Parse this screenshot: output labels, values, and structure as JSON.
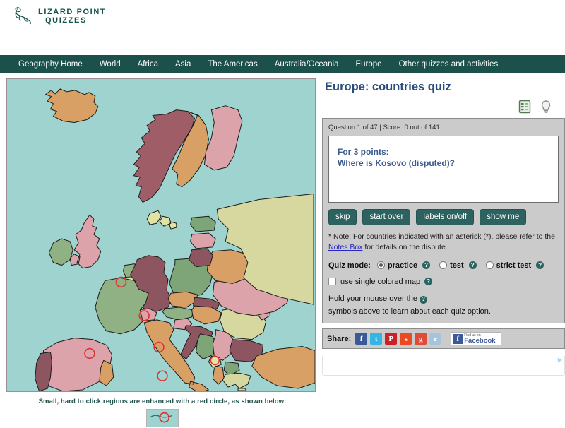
{
  "site": {
    "logo_line1": "LIZARD POINT",
    "logo_line2": "QUIZZES",
    "logo_icon": "lizard-icon"
  },
  "nav": {
    "items": [
      {
        "label": "Geography Home"
      },
      {
        "label": "World"
      },
      {
        "label": "Africa"
      },
      {
        "label": "Asia"
      },
      {
        "label": "The Americas"
      },
      {
        "label": "Australia/Oceania"
      },
      {
        "label": "Europe"
      },
      {
        "label": "Other quizzes and activities"
      }
    ]
  },
  "quiz": {
    "title": "Europe: countries quiz",
    "notes_icon": "notes-document-icon",
    "hint_icon": "lightbulb-icon",
    "status": "Question 1 of 47 | Score: 0 out of 141",
    "question_line1": "For 3 points:",
    "question_line2": "Where is Kosovo (disputed)?",
    "buttons": [
      {
        "label": "skip",
        "name": "skip-button"
      },
      {
        "label": "start over",
        "name": "start-over-button"
      },
      {
        "label": "labels on/off",
        "name": "labels-toggle-button"
      },
      {
        "label": "show me",
        "name": "show-me-button"
      }
    ],
    "note_prefix": "* Note: For countries indicated with an asterisk (*), please refer to the ",
    "note_link": "Notes Box",
    "note_suffix": " for details on the dispute.",
    "mode_label": "Quiz mode:",
    "modes": [
      {
        "label": "practice",
        "selected": true
      },
      {
        "label": "test",
        "selected": false
      },
      {
        "label": "strict test",
        "selected": false
      }
    ],
    "single_map_label": "use single colored map",
    "single_map_checked": false,
    "help_glyph": "?",
    "hint_before": "Hold your mouse over the",
    "hint_after": "symbols above to learn about each quiz option."
  },
  "map": {
    "caption": "Small, hard to click regions are enhanced with a red circle, as shown below:",
    "ocean_color": "#9fd3d0",
    "border_color": "#9a8f96",
    "highlight_circle_color": "#e03030",
    "regions": [
      {
        "name": "Iceland",
        "color": "#d9a066"
      },
      {
        "name": "Norway",
        "color": "#9e5d67"
      },
      {
        "name": "Sweden",
        "color": "#d9a066"
      },
      {
        "name": "Finland",
        "color": "#dda3aa"
      },
      {
        "name": "Denmark",
        "color": "#e1e2a3"
      },
      {
        "name": "United Kingdom",
        "color": "#dda3aa"
      },
      {
        "name": "Ireland",
        "color": "#8fb183"
      },
      {
        "name": "Estonia",
        "color": "#7ea578"
      },
      {
        "name": "Latvia",
        "color": "#dda3aa"
      },
      {
        "name": "Lithuania",
        "color": "#8d5560"
      },
      {
        "name": "Belarus",
        "color": "#d9a066"
      },
      {
        "name": "Poland",
        "color": "#7ea578"
      },
      {
        "name": "Russia",
        "color": "#d7d8a0"
      },
      {
        "name": "Ukraine",
        "color": "#dda3aa"
      },
      {
        "name": "Germany",
        "color": "#8d5560"
      },
      {
        "name": "Netherlands",
        "color": "#8fb183"
      },
      {
        "name": "Belgium",
        "color": "#e1e2a3"
      },
      {
        "name": "France",
        "color": "#8fb183"
      },
      {
        "name": "Spain",
        "color": "#dda3aa"
      },
      {
        "name": "Portugal",
        "color": "#8d5560"
      },
      {
        "name": "Switzerland",
        "color": "#dda3aa"
      },
      {
        "name": "Austria",
        "color": "#8fb183"
      },
      {
        "name": "Czechia",
        "color": "#d9a066"
      },
      {
        "name": "Slovakia",
        "color": "#8d5560"
      },
      {
        "name": "Hungary",
        "color": "#d9a066"
      },
      {
        "name": "Italy",
        "color": "#d9a066"
      },
      {
        "name": "Slovenia",
        "color": "#dda3aa"
      },
      {
        "name": "Croatia",
        "color": "#8d5560"
      },
      {
        "name": "Bosnia",
        "color": "#7ea578"
      },
      {
        "name": "Serbia",
        "color": "#dda3aa"
      },
      {
        "name": "Montenegro",
        "color": "#e1e2a3"
      },
      {
        "name": "Albania",
        "color": "#d9a066"
      },
      {
        "name": "North Macedonia",
        "color": "#7ea578"
      },
      {
        "name": "Greece",
        "color": "#d7d8a0"
      },
      {
        "name": "Bulgaria",
        "color": "#8d5560"
      },
      {
        "name": "Romania",
        "color": "#d7d8a0"
      },
      {
        "name": "Moldova",
        "color": "#dda3aa"
      },
      {
        "name": "Turkey",
        "color": "#d9a066"
      }
    ]
  },
  "share": {
    "label": "Share:",
    "icons": [
      {
        "name": "facebook-share-icon",
        "glyph": "f",
        "color": "#3b5998"
      },
      {
        "name": "twitter-share-icon",
        "glyph": "t",
        "color": "#33b5e5"
      },
      {
        "name": "pinterest-share-icon",
        "glyph": "P",
        "color": "#cb2027"
      },
      {
        "name": "stumbleupon-share-icon",
        "glyph": "s",
        "color": "#eb4924"
      },
      {
        "name": "googleplus-share-icon",
        "glyph": "g",
        "color": "#dd4b39"
      },
      {
        "name": "reddit-share-icon",
        "glyph": "r",
        "color": "#a8c4dd"
      }
    ],
    "facebook_badge_line1": "Find us on",
    "facebook_badge_line2": "Facebook",
    "facebook_badge_glyph": "f"
  }
}
